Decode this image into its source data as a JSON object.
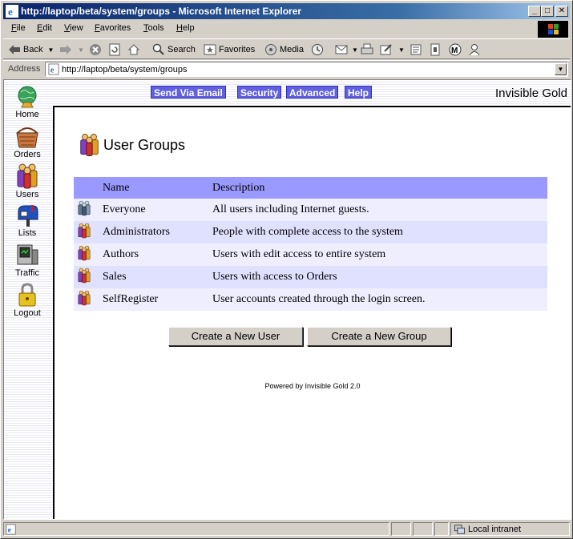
{
  "window": {
    "title": "http://laptop/beta/system/groups - Microsoft Internet Explorer",
    "controls": {
      "minimize": "_",
      "maximize": "□",
      "close": "✕"
    }
  },
  "menu": [
    {
      "label": "File",
      "underline": "F",
      "rest": "ile"
    },
    {
      "label": "Edit",
      "underline": "E",
      "rest": "dit"
    },
    {
      "label": "View",
      "underline": "V",
      "rest": "iew"
    },
    {
      "label": "Favorites",
      "underline": "F",
      "rest": "avorites"
    },
    {
      "label": "Tools",
      "underline": "T",
      "rest": "ools"
    },
    {
      "label": "Help",
      "underline": "H",
      "rest": "elp"
    }
  ],
  "toolbar": {
    "back": "Back",
    "search": "Search",
    "favorites": "Favorites",
    "media": "Media"
  },
  "address": {
    "label": "Address",
    "url": "http://laptop/beta/system/groups"
  },
  "sidenav": {
    "home": "Home",
    "orders": "Orders",
    "users": "Users",
    "lists": "Lists",
    "traffic": "Traffic",
    "logout": "Logout"
  },
  "topnav": {
    "send_email": "Send Via Email",
    "security": "Security",
    "advanced": "Advanced",
    "help": "Help",
    "brand": "Invisible Gold"
  },
  "page": {
    "heading": "User Groups",
    "columns": {
      "name": "Name",
      "description": "Description"
    },
    "groups": [
      {
        "name": "Everyone",
        "description": "All users including Internet guests.",
        "icon": "group-people-icon"
      },
      {
        "name": "Administrators",
        "description": "People with complete access to the system",
        "icon": "group-people-icon"
      },
      {
        "name": "Authors",
        "description": "Users with edit access to entire system",
        "icon": "group-people-icon"
      },
      {
        "name": "Sales",
        "description": "Users with access to Orders",
        "icon": "group-people-icon"
      },
      {
        "name": "SelfRegister",
        "description": "User accounts created through the login screen.",
        "icon": "group-people-icon"
      }
    ],
    "create_user": "Create a New User",
    "create_group": "Create a New Group",
    "powered_by": "Powered by Invisible Gold 2.0"
  },
  "status": {
    "zone": "Local intranet"
  },
  "colors": {
    "header_row": "#9999ff",
    "row_odd": "#eeeeff",
    "row_even": "#e0e0ff",
    "nav_button": "#6060e0",
    "titlebar": "#0a246a"
  }
}
